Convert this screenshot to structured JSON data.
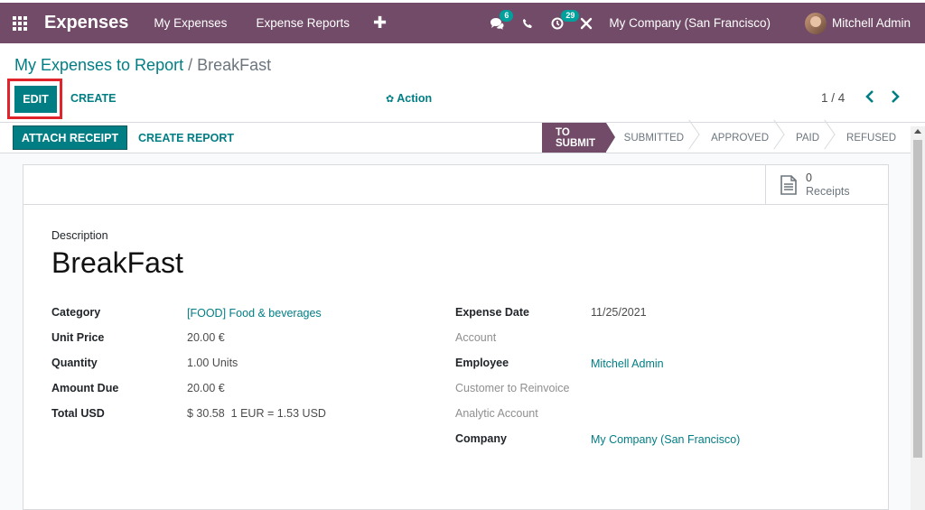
{
  "navbar": {
    "app_title": "Expenses",
    "menu": [
      "My Expenses",
      "Expense Reports"
    ],
    "add_symbol": "✚",
    "messages_count": "6",
    "activities_count": "29",
    "company": "My Company (San Francisco)",
    "user": "Mitchell Admin",
    "icons": [
      "apps-grid-icon",
      "chat-icon",
      "phone-icon",
      "activity-clock-icon",
      "debug-tools-icon"
    ]
  },
  "breadcrumb": {
    "parent": "My Expenses to Report",
    "separator": "/",
    "current": "BreakFast"
  },
  "control": {
    "edit_label": "EDIT",
    "create_label": "CREATE",
    "action_label": "Action",
    "pager": "1 / 4"
  },
  "status": {
    "attach_label": "ATTACH RECEIPT",
    "create_report_label": "CREATE REPORT",
    "stages": [
      "TO SUBMIT",
      "SUBMITTED",
      "APPROVED",
      "PAID",
      "REFUSED"
    ],
    "active_stage": "TO SUBMIT"
  },
  "form": {
    "receipts_count": "0",
    "receipts_label": "Receipts",
    "description_label": "Description",
    "title": "BreakFast",
    "left_fields": [
      {
        "label": "Category",
        "value": "[FOOD] Food & beverages"
      },
      {
        "label": "Unit Price",
        "value": "20.00 €"
      },
      {
        "label": "Quantity",
        "value": "1.00",
        "unit": "Units"
      },
      {
        "label": "Amount Due",
        "value": "20.00 €"
      },
      {
        "label": "Total USD",
        "value": "$ 30.58",
        "rate": "1 EUR = 1.53 USD"
      }
    ],
    "right_fields": [
      {
        "label": "Expense Date",
        "value": "11/25/2021"
      },
      {
        "label": "Account",
        "value": ""
      },
      {
        "label": "Employee",
        "value": "Mitchell Admin"
      },
      {
        "label": "Customer to Reinvoice",
        "value": ""
      },
      {
        "label": "Analytic Account",
        "value": ""
      },
      {
        "label": "Company",
        "value": "My Company (San Francisco)"
      }
    ]
  },
  "colors": {
    "brand": "#714b67",
    "accent": "#017e84",
    "highlight": "#e0242b"
  }
}
